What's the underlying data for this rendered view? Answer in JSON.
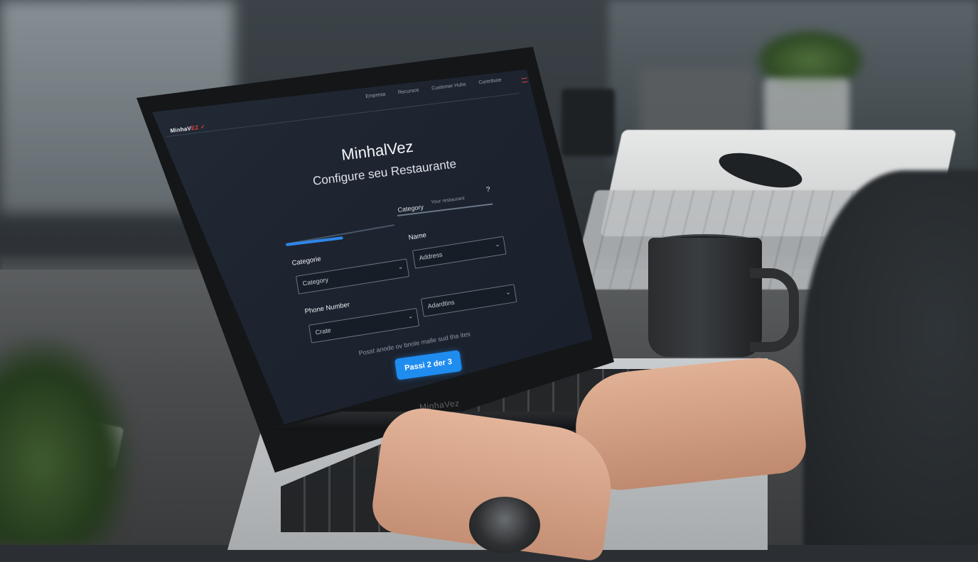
{
  "nav": {
    "items": [
      "Empresa",
      "Recursos",
      "Customer Hubs",
      "Contribute"
    ]
  },
  "logo": {
    "text_main": "MinhaV",
    "text_accent": "EZ"
  },
  "app": {
    "title": "MinhalVez",
    "subtitle": "Configure seu Restaurante"
  },
  "top_field": {
    "label": "Category",
    "placeholder": "Your restaurant",
    "help_icon": "?"
  },
  "progress": {
    "value": 0.52
  },
  "fields": {
    "categorie_label": "Categorie",
    "category_value": "Category",
    "name_label": "Name",
    "address_value": "Address",
    "phone_label": "Phone Number",
    "create_value": "Crate",
    "additional_value": "Adardtins"
  },
  "hint": "Posst anode ov bnole malle sud tha ites",
  "cta": {
    "label": "Passi 2 der 3"
  },
  "base_brand": "MinhaVez",
  "icons": {
    "chevron": "chevron-down-icon",
    "menu": "hamburger-menu-icon",
    "help": "question-icon"
  },
  "colors": {
    "accent": "#1f8cf0",
    "brand_red": "#e0443a",
    "screen_bg": "#1d2430"
  }
}
